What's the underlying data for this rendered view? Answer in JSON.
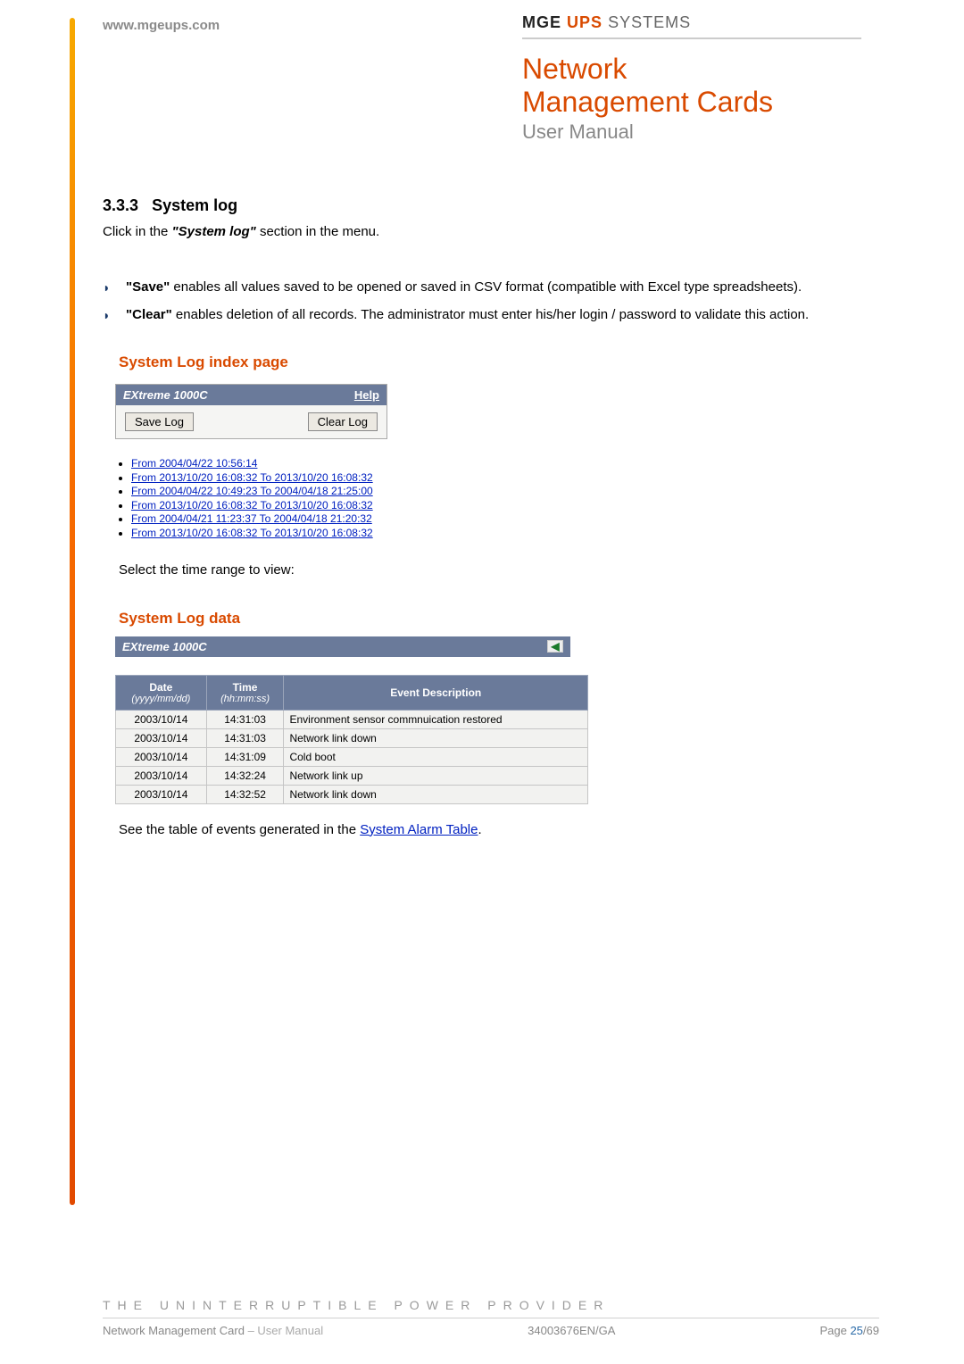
{
  "header": {
    "url": "www.mgeups.com",
    "brand_mge": "MGE",
    "brand_ups": "UPS",
    "brand_sys": "SYSTEMS",
    "title_line1": "Network",
    "title_line2": "Management Cards",
    "subtitle": "User Manual"
  },
  "section": {
    "number": "3.3.3",
    "title": "System log",
    "intro_pre": "Click in the ",
    "intro_bold": "\"System log\"",
    "intro_post": " section in the menu.",
    "bullets": [
      {
        "bold": "\"Save\"",
        "text": " enables all values saved to be opened or saved in CSV format (compatible with Excel type spreadsheets)."
      },
      {
        "bold": "\"Clear\"",
        "text": " enables deletion of all records. The administrator must enter his/her login / password to validate this action."
      }
    ]
  },
  "index_page": {
    "heading": "System Log index page",
    "device": "EXtreme 1000C",
    "help": "Help",
    "save_btn": "Save Log",
    "clear_btn": "Clear Log",
    "ranges": [
      "From 2004/04/22 10:56:14",
      "From 2013/10/20 16:08:32 To 2013/10/20 16:08:32",
      "From 2004/04/22 10:49:23 To 2004/04/18 21:25:00",
      "From 2013/10/20 16:08:32 To 2013/10/20 16:08:32",
      "From 2004/04/21 11:23:37 To 2004/04/18 21:20:32",
      "From 2013/10/20 16:08:32 To 2013/10/20 16:08:32"
    ],
    "select_text": "Select the time range to view:"
  },
  "log_data": {
    "heading": "System Log data",
    "device": "EXtreme 1000C",
    "cols": {
      "date": "Date",
      "date_sub": "(yyyy/mm/dd)",
      "time": "Time",
      "time_sub": "(hh:mm:ss)",
      "event": "Event Description"
    },
    "rows": [
      {
        "date": "2003/10/14",
        "time": "14:31:03",
        "event": "Environment sensor commnuication restored"
      },
      {
        "date": "2003/10/14",
        "time": "14:31:03",
        "event": "Network link down"
      },
      {
        "date": "2003/10/14",
        "time": "14:31:09",
        "event": "Cold boot"
      },
      {
        "date": "2003/10/14",
        "time": "14:32:24",
        "event": "Network link up"
      },
      {
        "date": "2003/10/14",
        "time": "14:32:52",
        "event": "Network link down"
      }
    ],
    "see_pre": "See the table of events generated in the ",
    "see_link": "System Alarm Table",
    "see_post": "."
  },
  "footer": {
    "tagline": "THE UNINTERRUPTIBLE POWER PROVIDER",
    "doc_name": "Network Management Card",
    "doc_sub": " – User Manual",
    "doc_code": "34003676EN/GA",
    "page_label": "Page ",
    "page_cur": "25",
    "page_total": "/69"
  }
}
